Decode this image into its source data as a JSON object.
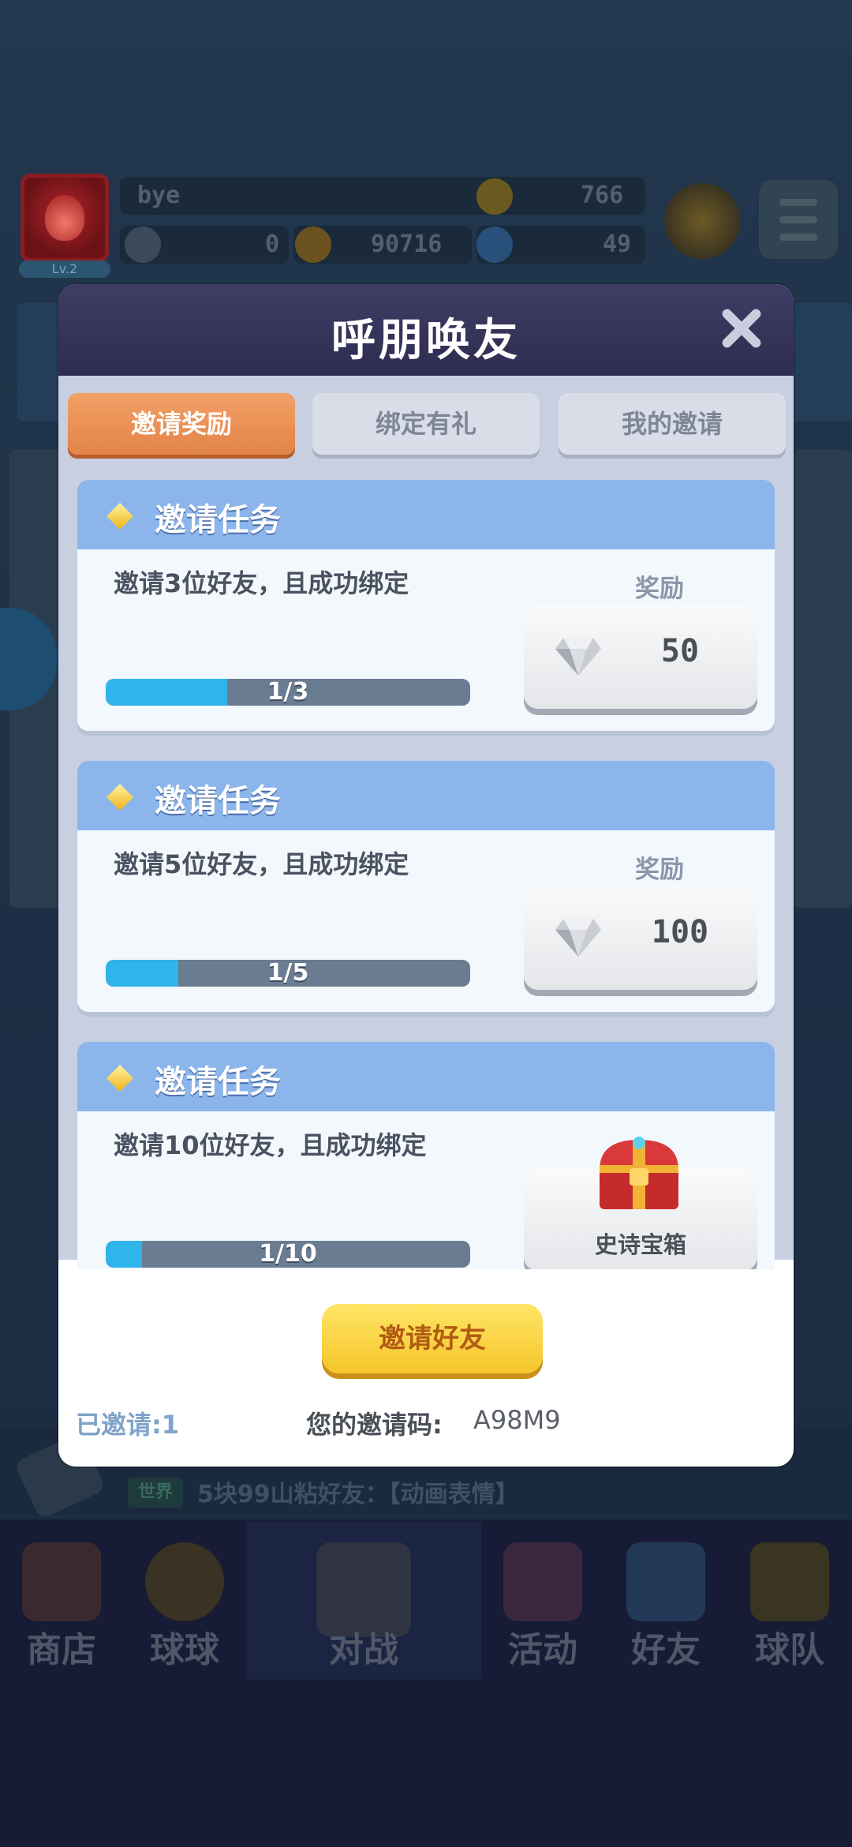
{
  "hud": {
    "player_name": "bye",
    "level": "Lv.2",
    "trophies": "766",
    "stat_zero": "0",
    "coins": "90716",
    "gems": "49"
  },
  "chat": {
    "channel": "世界",
    "message": "5块99山粘好友：【动画表情】"
  },
  "nav": {
    "items": [
      {
        "label": "商店"
      },
      {
        "label": "球球"
      },
      {
        "label": "对战"
      },
      {
        "label": "活动"
      },
      {
        "label": "好友"
      },
      {
        "label": "球队"
      }
    ]
  },
  "modal": {
    "title": "呼朋唤友",
    "tabs": [
      {
        "label": "邀请奖励",
        "active": true
      },
      {
        "label": "绑定有礼",
        "active": false
      },
      {
        "label": "我的邀请",
        "active": false
      }
    ],
    "tasks": [
      {
        "title": "邀请任务",
        "desc": "邀请3位好友，且成功绑定",
        "reward_label": "奖励",
        "progress_text": "1/3",
        "progress_fraction": 0.333,
        "reward_amount": "50",
        "reward_icon": "diamond-icon"
      },
      {
        "title": "邀请任务",
        "desc": "邀请5位好友，且成功绑定",
        "reward_label": "奖励",
        "progress_text": "1/5",
        "progress_fraction": 0.2,
        "reward_amount": "100",
        "reward_icon": "diamond-icon"
      },
      {
        "title": "邀请任务",
        "desc": "邀请10位好友，且成功绑定",
        "progress_text": "1/10",
        "progress_fraction": 0.1,
        "reward_name": "史诗宝箱",
        "reward_icon": "treasure-chest-icon"
      }
    ],
    "invite_button": "邀请好友",
    "invited_count": "已邀请:1",
    "code_label": "您的邀请码:",
    "code_value": "A98M9"
  },
  "colors": {
    "tab_active": "#e38448",
    "card_header": "#8cb5ec",
    "progress_fill": "#30b5ea",
    "invite_button": "#f5c62a"
  }
}
